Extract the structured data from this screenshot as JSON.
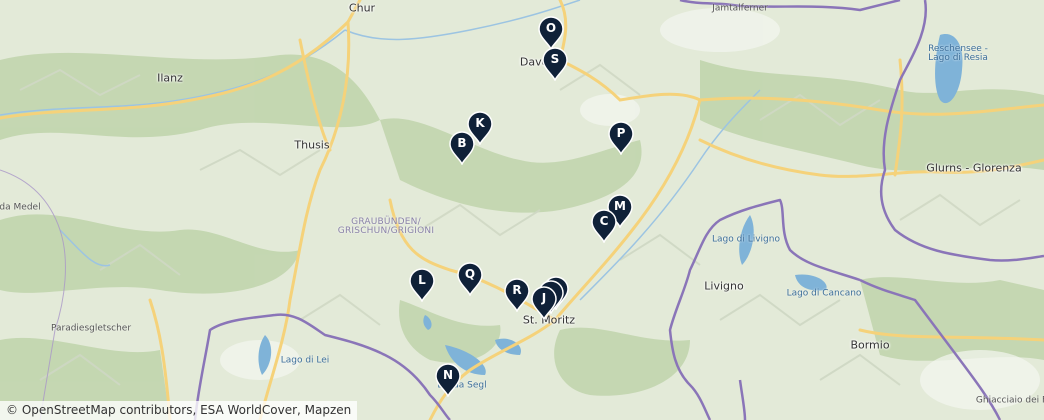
{
  "map": {
    "places": [
      {
        "id": "chur",
        "name": "Chur",
        "kind": "city"
      },
      {
        "id": "davos",
        "name": "Davos",
        "kind": "city"
      },
      {
        "id": "ilanz",
        "name": "Ilanz",
        "kind": "city"
      },
      {
        "id": "thusis",
        "name": "Thusis",
        "kind": "city"
      },
      {
        "id": "st-moritz",
        "name": "St. Moritz",
        "kind": "city"
      },
      {
        "id": "livigno",
        "name": "Livigno",
        "kind": "city"
      },
      {
        "id": "bormio",
        "name": "Bormio",
        "kind": "city"
      },
      {
        "id": "glurns",
        "name": "Glurns - Glorenza",
        "kind": "city"
      },
      {
        "id": "jamtalferner",
        "name": "Jamtalferner",
        "kind": "small"
      },
      {
        "id": "reschensee",
        "name": "Reschensee -\nLago di Resia",
        "kind": "water"
      },
      {
        "id": "graubuenden",
        "name": "GRAUBÜNDEN/\nGRISCHUN/GRIGIONI",
        "kind": "region"
      },
      {
        "id": "lago-livigno",
        "name": "Lago di Livigno",
        "kind": "water"
      },
      {
        "id": "lago-cancano",
        "name": "Lago di Cancano",
        "kind": "water"
      },
      {
        "id": "paradies",
        "name": "Paradiesgletscher",
        "kind": "small"
      },
      {
        "id": "lago-lei",
        "name": "Lago di Lei",
        "kind": "water"
      },
      {
        "id": "lej-segl",
        "name": "Lej da Segl",
        "kind": "water"
      },
      {
        "id": "da-medel",
        "name": "da Medel",
        "kind": "small"
      },
      {
        "id": "ghiacciaio",
        "name": "Ghiacciaio dei Forni",
        "kind": "small"
      }
    ],
    "markers": [
      {
        "letter": "O"
      },
      {
        "letter": "S"
      },
      {
        "letter": "K"
      },
      {
        "letter": "B"
      },
      {
        "letter": "P"
      },
      {
        "letter": "M"
      },
      {
        "letter": "C"
      },
      {
        "letter": "L"
      },
      {
        "letter": "Q"
      },
      {
        "letter": "R"
      },
      {
        "letter": "J"
      },
      {
        "letter": "N"
      }
    ],
    "colors": {
      "marker": "#0f2138",
      "terrain": "#e3ead8",
      "forest": "#bfd4ab",
      "road": "#f5d27a",
      "water": "#7fb3d8",
      "border": "#8a75b8"
    }
  },
  "attribution": "© OpenStreetMap contributors, ESA WorldCover, Mapzen"
}
